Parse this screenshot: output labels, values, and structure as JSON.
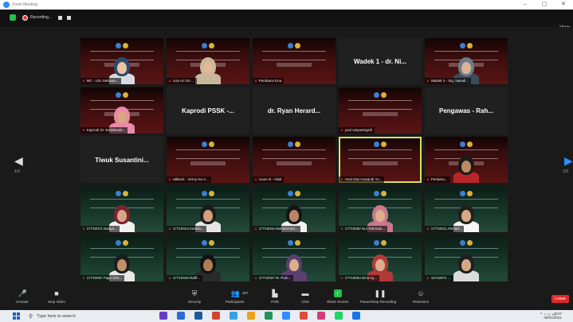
{
  "window": {
    "title": "Zoom Meeting"
  },
  "recording": {
    "status": "Recording..."
  },
  "view_label": "View",
  "nav": {
    "left_page": "1/3",
    "right_page": "1/3"
  },
  "tiles": [
    {
      "kind": "banner",
      "name": "MC - Lilis Setiawa...",
      "muted": true,
      "person": "hijab-teal"
    },
    {
      "kind": "banner",
      "name": "Lisa Ari Oe ...",
      "muted": true,
      "person": "hijab-beige"
    },
    {
      "kind": "banner",
      "name": "Pembaca Doa",
      "muted": true,
      "person": ""
    },
    {
      "kind": "black",
      "center": "Wadek 1 - dr. Ni...",
      "name": "",
      "muted": false
    },
    {
      "kind": "banner",
      "name": "Wadek 3 - drg. Nanuli...",
      "muted": true,
      "person": "hijab-grey"
    },
    {
      "kind": "banner",
      "name": "Kaprodi Dr. Endahwati...",
      "muted": true,
      "person": "hijab-pink"
    },
    {
      "kind": "black",
      "center": "Kaprodi PSSK -...",
      "name": "",
      "muted": false
    },
    {
      "kind": "black",
      "center": "dr. Ryan Herard...",
      "name": "",
      "muted": false
    },
    {
      "kind": "banner",
      "name": "yuni setyaningsih",
      "muted": true,
      "person": ""
    },
    {
      "kind": "black",
      "center": "Pengawas - Rah...",
      "name": "",
      "muted": false
    },
    {
      "kind": "black",
      "center": "Tiwuk Susantini...",
      "name": "",
      "muted": false
    },
    {
      "kind": "banner",
      "name": "Hilbeck - Verny No A...",
      "muted": true,
      "person": ""
    },
    {
      "kind": "banner",
      "name": "zoom N - Hilal",
      "muted": true,
      "person": ""
    },
    {
      "kind": "banner",
      "name": "Host-Dwi Anwandi Yu...",
      "muted": true,
      "person": "",
      "active": true
    },
    {
      "kind": "banner",
      "name": "Pertama...",
      "muted": true,
      "person": "man-mask"
    },
    {
      "kind": "green",
      "name": "17710071 Nadya...",
      "muted": true,
      "person": "hijab-maroon"
    },
    {
      "kind": "green",
      "name": "17710014 Kamila...",
      "muted": true,
      "person": "girl-dark"
    },
    {
      "kind": "green",
      "name": "17710044 Muhammad...",
      "muted": true,
      "person": "man-dark"
    },
    {
      "kind": "green",
      "name": "17710062 Nur Rahman...",
      "muted": true,
      "person": "hijab-rose"
    },
    {
      "kind": "green",
      "name": "17710011 Ahmad...",
      "muted": true,
      "person": "man-light"
    },
    {
      "kind": "green",
      "name": "17710057 Fajar Dim...",
      "muted": true,
      "person": "man-tan"
    },
    {
      "kind": "green",
      "name": "17710043 Rafif...",
      "muted": true,
      "person": "man-dark2"
    },
    {
      "kind": "green",
      "name": "17710037 M. Putri...",
      "muted": true,
      "person": "hijab-purple"
    },
    {
      "kind": "green",
      "name": "17710063 Dina Ay...",
      "muted": true,
      "person": "hijab-red"
    },
    {
      "kind": "green",
      "name": "16710071 ...",
      "muted": true,
      "person": "man-light2"
    }
  ],
  "toolbar": {
    "unmute": "Unmute",
    "stop_video": "Stop Video",
    "security": "Security",
    "participants": "Participants",
    "participants_count": "307",
    "polls": "Polls",
    "chat": "Chat",
    "share_screen": "Share Screen",
    "pause_recording": "Pause/Stop Recording",
    "reactions": "Reactions",
    "leave": "Leave"
  },
  "taskbar": {
    "search_placeholder": "Type here to search",
    "clock_line1": "9:07",
    "clock_line2": "06/01/2021"
  },
  "colors": {
    "zoom_blue": "#2d8cff",
    "leave_red": "#e02828",
    "active_speaker": "#d9e35a",
    "share_green": "#23c14b"
  }
}
